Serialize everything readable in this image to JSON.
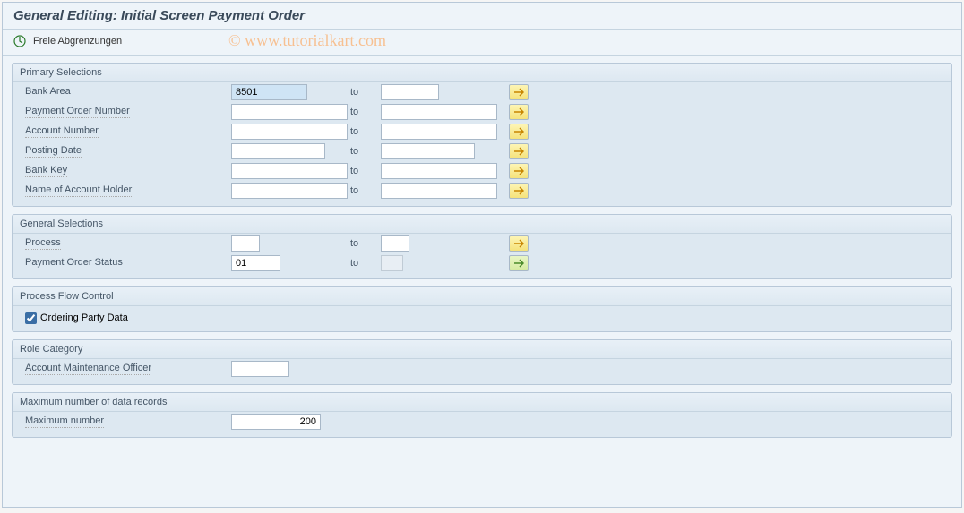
{
  "header": {
    "title": "General Editing: Initial Screen Payment Order"
  },
  "toolbar": {
    "free_selections": "Freie Abgrenzungen"
  },
  "watermark": "© www.tutorialkart.com",
  "primary": {
    "title": "Primary Selections",
    "to_label": "to",
    "rows": {
      "bank_area": {
        "label": "Bank Area",
        "from": "8501",
        "to": ""
      },
      "payment_order_number": {
        "label": "Payment Order Number",
        "from": "",
        "to": ""
      },
      "account_number": {
        "label": "Account Number",
        "from": "",
        "to": ""
      },
      "posting_date": {
        "label": "Posting Date",
        "from": "",
        "to": ""
      },
      "bank_key": {
        "label": "Bank Key",
        "from": "",
        "to": ""
      },
      "account_holder": {
        "label": "Name of Account Holder",
        "from": "",
        "to": ""
      }
    }
  },
  "general": {
    "title": "General Selections",
    "rows": {
      "process": {
        "label": "Process",
        "from": "",
        "to": ""
      },
      "status": {
        "label": "Payment Order Status",
        "from": "01",
        "to": ""
      }
    }
  },
  "flow": {
    "title": "Process Flow Control",
    "ordering_party": {
      "label": "Ordering Party Data",
      "checked": true
    }
  },
  "role": {
    "title": "Role Category",
    "officer": {
      "label": "Account Maintenance Officer",
      "value": ""
    }
  },
  "max_records": {
    "title": "Maximum number of data records",
    "max": {
      "label": "Maximum number",
      "value": "200"
    }
  }
}
